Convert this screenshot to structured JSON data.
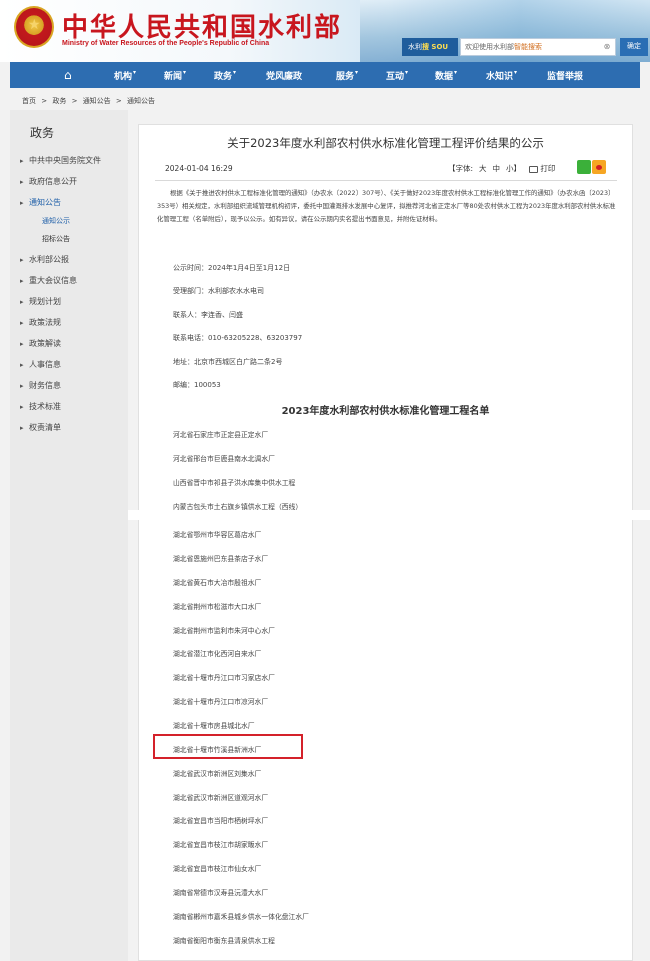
{
  "header": {
    "title": "中华人民共和国水利部",
    "subtitle": "Ministry of Water Resources of the People's Republic of China",
    "search_logo_prefix": "水利",
    "search_logo_suffix": "搜 SOU",
    "search_placeholder_prefix": "欢迎使用水利部",
    "search_placeholder_highlight": "智能搜索",
    "search_button": "确定"
  },
  "nav": {
    "items": [
      "机构",
      "新闻",
      "政务",
      "党风廉政",
      "服务",
      "互动",
      "数据",
      "水知识",
      "监督举报"
    ]
  },
  "breadcrumb": [
    "首页",
    ">",
    "政务",
    ">",
    "通知公告",
    ">",
    "通知公告"
  ],
  "sidebar": {
    "title": "政务",
    "items": [
      {
        "label": "中共中央国务院文件",
        "type": "main"
      },
      {
        "label": "政府信息公开",
        "type": "main"
      },
      {
        "label": "通知公告",
        "type": "active"
      },
      {
        "label": "通知公示",
        "type": "sub-current"
      },
      {
        "label": "招标公告",
        "type": "sub"
      },
      {
        "label": "水利部公报",
        "type": "main"
      },
      {
        "label": "重大会议信息",
        "type": "main"
      },
      {
        "label": "规划计划",
        "type": "main"
      },
      {
        "label": "政策法规",
        "type": "main"
      },
      {
        "label": "政策解读",
        "type": "main"
      },
      {
        "label": "人事信息",
        "type": "main"
      },
      {
        "label": "财务信息",
        "type": "main"
      },
      {
        "label": "技术标准",
        "type": "main"
      },
      {
        "label": "权责清单",
        "type": "main"
      }
    ]
  },
  "article": {
    "title": "关于2023年度水利部农村供水标准化管理工程评价结果的公示",
    "date": "2024-01-04 16:29",
    "font_label": "【字体:",
    "font_large": "大",
    "font_medium": "中",
    "font_small": "小】",
    "print_label": "打印",
    "paragraph": "根据《关于推进农村供水工程标准化管理的通知》（办农水〔2022〕307号）、《关于做好2023年度农村供水工程标准化管理工作的通知》（办农水函〔2023〕353号）相关规定，水利部组织流域管理机构初评，委托中国灌溉排水发展中心复评，拟推荐河北省正定水厂等80处农村供水工程为2023年度水利部农村供水标准化管理工程（名单附后），现予以公示。如有异议，请在公示期内实名提出书面意见，并附佐证材料。",
    "info": [
      "公示时间：2024年1月4日至1月12日",
      "受理部门：水利部农水水电司",
      "联系人：李连香、闫盛",
      "联系电话：010-63205228、63203797",
      "地址：北京市西城区白广路二条2号",
      "邮编：100053"
    ],
    "list_title": "2023年度水利部农村供水标准化管理工程名单",
    "projects": [
      "河北省石家庄市正定县正定水厂",
      "河北省邢台市巨鹿县南水北调水厂",
      "山西省晋中市祁县子洪水库集中供水工程",
      "内蒙古包头市土右旗乡镇供水工程（西线）",
      "湖北省鄂州市华容区葛店水厂",
      "湖北省恩施州巴东县茶店子水厂",
      "湖北省黄石市大冶市殷祖水厂",
      "湖北省荆州市松滋市大口水厂",
      "湖北省荆州市监利市朱河中心水厂",
      "湖北省潜江市化西河自来水厂",
      "湖北省十堰市丹江口市习家店水厂",
      "湖北省十堰市丹江口市凉河水厂",
      "湖北省十堰市房县城北水厂",
      "湖北省十堰市竹溪县新洲水厂",
      "湖北省武汉市新洲区刘集水厂",
      "湖北省武汉市新洲区道观河水厂",
      "湖北省宜昌市当阳市栖树坪水厂",
      "湖北省宜昌市枝江市胡家畈水厂",
      "湖北省宜昌市枝江市仙女水厂",
      "湖南省常德市汉寿县沅澧大水厂",
      "湖南省郴州市嘉禾县城乡供水一体化盘江水厂",
      "湖南省衡阳市衡东县清泉供水工程"
    ]
  }
}
